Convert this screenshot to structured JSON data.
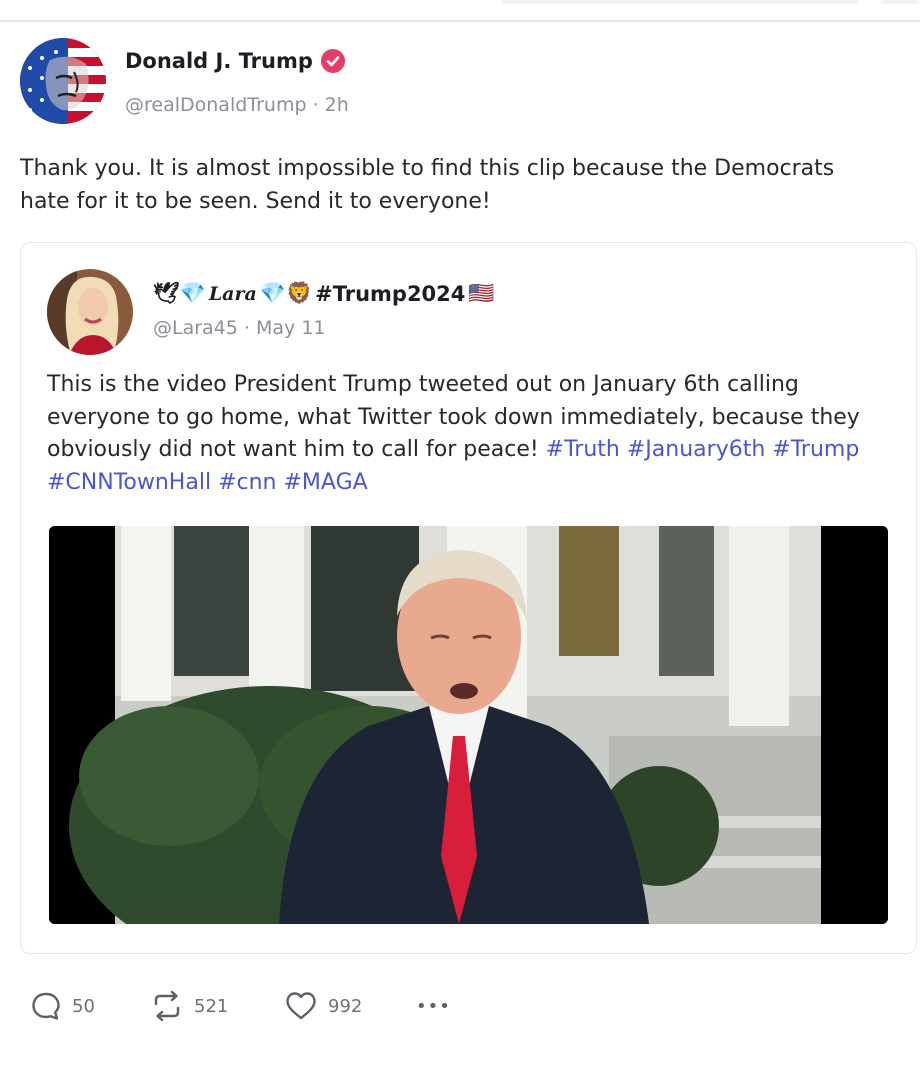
{
  "post": {
    "author_name": "Donald J. Trump",
    "handle": "@realDonaldTrump",
    "separator": "·",
    "time": "2h",
    "text": "Thank you. It is almost impossible to find this clip because the Democrats hate for it to be seen. Send it to everyone!"
  },
  "quoted": {
    "name_prefix_emoji": "🕊💎",
    "name_script": "Lara",
    "name_suffix_emoji": "💎🦁",
    "name_tag": "#Trump2024",
    "name_flag": "🇺🇸",
    "handle": "@Lara45",
    "separator": "·",
    "date": "May 11",
    "text": "This is the video President Trump tweeted out on January 6th calling everyone to go home, what Twitter took down immediately, because they obviously did not want him to call for peace! ",
    "hashtags": [
      "#Truth",
      "#January6th",
      "#Trump",
      "#CNNTownHall",
      "#cnn",
      "#MAGA"
    ]
  },
  "actions": {
    "replies": "50",
    "retruths": "521",
    "likes": "992",
    "more": "•••"
  },
  "colors": {
    "verified": "#e43d6a",
    "hashtag": "#4a56d1",
    "muted": "#8a8f98"
  },
  "icons": [
    "verified-badge-icon",
    "reply-icon",
    "retruth-icon",
    "like-icon",
    "more-icon"
  ]
}
